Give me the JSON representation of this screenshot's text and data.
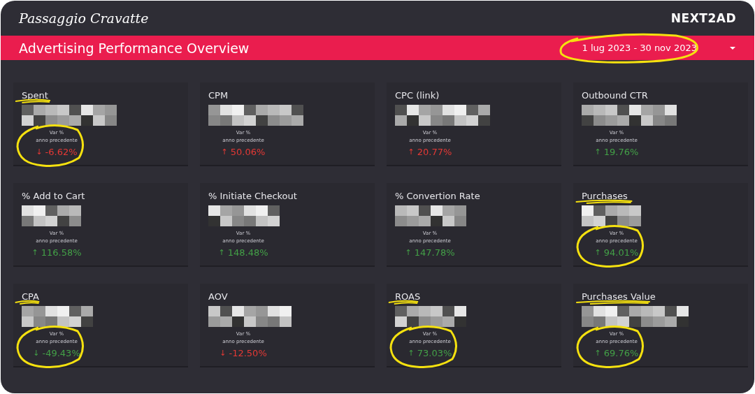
{
  "brand": "Passaggio Cravatte",
  "logo": "NEXT2AD",
  "header": {
    "title": "Advertising Performance Overview",
    "date_range": "1 lug 2023 - 30 nov 2023",
    "date_highlighted": true
  },
  "metrics": [
    {
      "title": "Spent",
      "caption": "Var %",
      "subcaption": "anno precedente",
      "change": "-6.62%",
      "arrow": "↓",
      "color": "#e53935",
      "title_underlined": true,
      "change_circled": true
    },
    {
      "title": "CPM",
      "caption": "Var %",
      "subcaption": "anno precedente",
      "change": "50.06%",
      "arrow": "↑",
      "color": "#e53935",
      "title_underlined": false,
      "change_circled": false
    },
    {
      "title": "CPC (link)",
      "caption": "Var %",
      "subcaption": "anno precedente",
      "change": "20.77%",
      "arrow": "↑",
      "color": "#e53935",
      "title_underlined": false,
      "change_circled": false
    },
    {
      "title": "Outbound CTR",
      "caption": "Var %",
      "subcaption": "anno precedente",
      "change": "19.76%",
      "arrow": "↑",
      "color": "#43a047",
      "title_underlined": false,
      "change_circled": false
    },
    {
      "title": "% Add to Cart",
      "caption": "Var %",
      "subcaption": "anno precedente",
      "change": "116.58%",
      "arrow": "↑",
      "color": "#43a047",
      "title_underlined": false,
      "change_circled": false
    },
    {
      "title": "% Initiate Checkout",
      "caption": "Var %",
      "subcaption": "anno precedente",
      "change": "148.48%",
      "arrow": "↑",
      "color": "#43a047",
      "title_underlined": false,
      "change_circled": false
    },
    {
      "title": "% Convertion Rate",
      "caption": "Var %",
      "subcaption": "anno precedente",
      "change": "147.78%",
      "arrow": "↑",
      "color": "#43a047",
      "title_underlined": false,
      "change_circled": false
    },
    {
      "title": "Purchases",
      "caption": "Var %",
      "subcaption": "anno precedente",
      "change": "94.01%",
      "arrow": "↑",
      "color": "#43a047",
      "title_underlined": true,
      "change_circled": true
    },
    {
      "title": "CPA",
      "caption": "Var %",
      "subcaption": "anno precedente",
      "change": "-49.43%",
      "arrow": "↓",
      "color": "#43a047",
      "title_underlined": true,
      "change_circled": true
    },
    {
      "title": "AOV",
      "caption": "Var %",
      "subcaption": "anno precedente",
      "change": "-12.50%",
      "arrow": "↓",
      "color": "#e53935",
      "title_underlined": false,
      "change_circled": false
    },
    {
      "title": "ROAS",
      "caption": "Var %",
      "subcaption": "anno precedente",
      "change": "73.03%",
      "arrow": "↑",
      "color": "#43a047",
      "title_underlined": true,
      "change_circled": true
    },
    {
      "title": "Purchases Value",
      "caption": "Var %",
      "subcaption": "anno precedente",
      "change": "69.76%",
      "arrow": "↑",
      "color": "#43a047",
      "title_underlined": true,
      "change_circled": true
    }
  ]
}
